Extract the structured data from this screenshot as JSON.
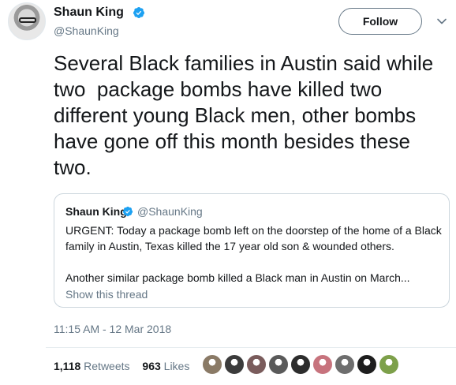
{
  "author": {
    "name": "Shaun King",
    "handle": "@ShaunKing"
  },
  "follow_label": "Follow",
  "tweet_text": "Several Black families in Austin said while two  package bombs have killed two different young Black men, other bombs have gone off this month besides these two.",
  "quoted_tweet": {
    "name": "Shaun King",
    "handle": "@ShaunKing",
    "paragraph1": "URGENT: Today a package bomb left on the doorstep of the home of a Black family in Austin, Texas killed the 17 year old son & wounded others.",
    "paragraph2": "Another similar package bomb killed a Black man in Austin on March...",
    "show_thread": "Show this thread"
  },
  "timestamp": "11:15 AM - 12 Mar 2018",
  "stats": {
    "retweets_count": "1,118",
    "retweets_label": "Retweets",
    "likes_count": "963",
    "likes_label": "Likes"
  },
  "colors": {
    "verified_blue": "#1da1f2",
    "text": "#14171a",
    "secondary": "#657786",
    "border": "#ccd6dd"
  },
  "likers": [
    {
      "color": "#8a7a66"
    },
    {
      "color": "#3b3b3b"
    },
    {
      "color": "#7a5c5c"
    },
    {
      "color": "#5a5a5a"
    },
    {
      "color": "#2d2d2d"
    },
    {
      "color": "#c7737d"
    },
    {
      "color": "#6e6e6e"
    },
    {
      "color": "#1e1e1e"
    },
    {
      "color": "#7da04a"
    }
  ]
}
